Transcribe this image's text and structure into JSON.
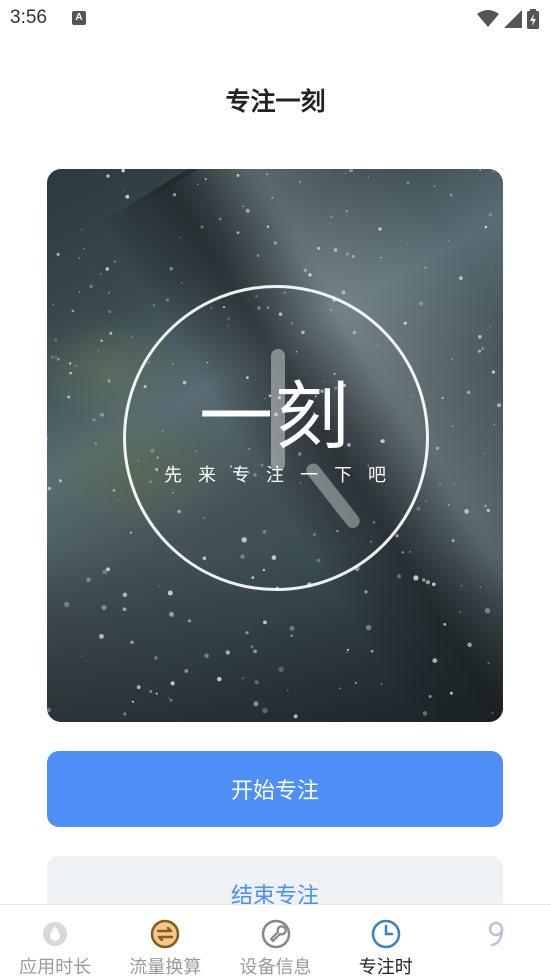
{
  "status_bar": {
    "time": "3:56",
    "notification_icon": "A"
  },
  "page": {
    "title": "专注一刻"
  },
  "hero": {
    "title": "一刻",
    "subtitle": "先来专注一下吧"
  },
  "actions": {
    "start_label": "开始专注",
    "end_label": "结束专注"
  },
  "tabs": [
    {
      "label": "应用时长",
      "icon": "water-drop-icon",
      "active": false
    },
    {
      "label": "流量换算",
      "icon": "swap-icon",
      "active": false
    },
    {
      "label": "设备信息",
      "icon": "wrench-icon",
      "active": false
    },
    {
      "label": "专注时",
      "icon": "clock-icon",
      "active": true
    },
    {
      "label": "",
      "icon": "number-nine-icon",
      "active": false
    }
  ],
  "colors": {
    "accent": "#4d8ff7",
    "secondary_button_bg": "#eef1f6",
    "active_tab_icon": "#3b82c4",
    "swap_icon": "#8a5a1e"
  }
}
